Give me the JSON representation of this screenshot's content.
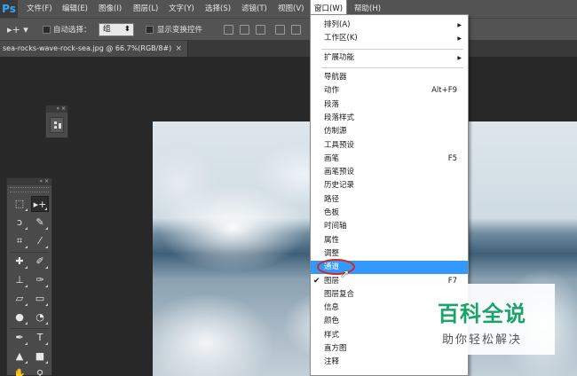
{
  "menubar": {
    "logo": "Ps",
    "items": [
      "文件(F)",
      "编辑(E)",
      "图像(I)",
      "图层(L)",
      "文字(Y)",
      "选择(S)",
      "滤镜(T)",
      "视图(V)",
      "窗口(W)",
      "帮助(H)"
    ],
    "active": "窗口(W)"
  },
  "options": {
    "auto_select_label": "自动选择：",
    "auto_select_value": "组",
    "show_transform_label": "显示变换控件"
  },
  "document": {
    "tab_title": "sea-rocks-wave-rock-sea.jpg @ 66.7%(RGB/8#)",
    "close": "×"
  },
  "panels": {
    "float_head": "» ×",
    "toolbox_head": "« ×"
  },
  "window_menu": {
    "group1": [
      {
        "label": "排列(A)",
        "submenu": true
      },
      {
        "label": "工作区(K)",
        "submenu": true
      }
    ],
    "group2": [
      {
        "label": "扩展功能",
        "submenu": true
      }
    ],
    "group3": [
      {
        "label": "导航器"
      },
      {
        "label": "动作",
        "shortcut": "Alt+F9"
      },
      {
        "label": "段落"
      },
      {
        "label": "段落样式"
      },
      {
        "label": "仿制源"
      },
      {
        "label": "工具预设"
      },
      {
        "label": "画笔",
        "shortcut": "F5"
      },
      {
        "label": "画笔预设"
      },
      {
        "label": "历史记录"
      },
      {
        "label": "路径"
      },
      {
        "label": "色板"
      },
      {
        "label": "时间轴"
      },
      {
        "label": "属性"
      },
      {
        "label": "调整"
      },
      {
        "label": "通道",
        "highlighted": true
      },
      {
        "label": "图层",
        "shortcut": "F7",
        "checked": true
      },
      {
        "label": "图层复合"
      },
      {
        "label": "信息"
      },
      {
        "label": "颜色"
      },
      {
        "label": "样式"
      },
      {
        "label": "直方图"
      },
      {
        "label": "注释"
      }
    ],
    "arrow_glyph": "▶",
    "check_glyph": "✔"
  },
  "watermark": {
    "title": "百科全说",
    "subtitle": "助你轻松解决"
  },
  "colors": {
    "accent": "#3399ff",
    "highlight_oval": "#d9261c",
    "watermark_green": "#1aa36a",
    "ps_blue": "#31a8ff"
  }
}
